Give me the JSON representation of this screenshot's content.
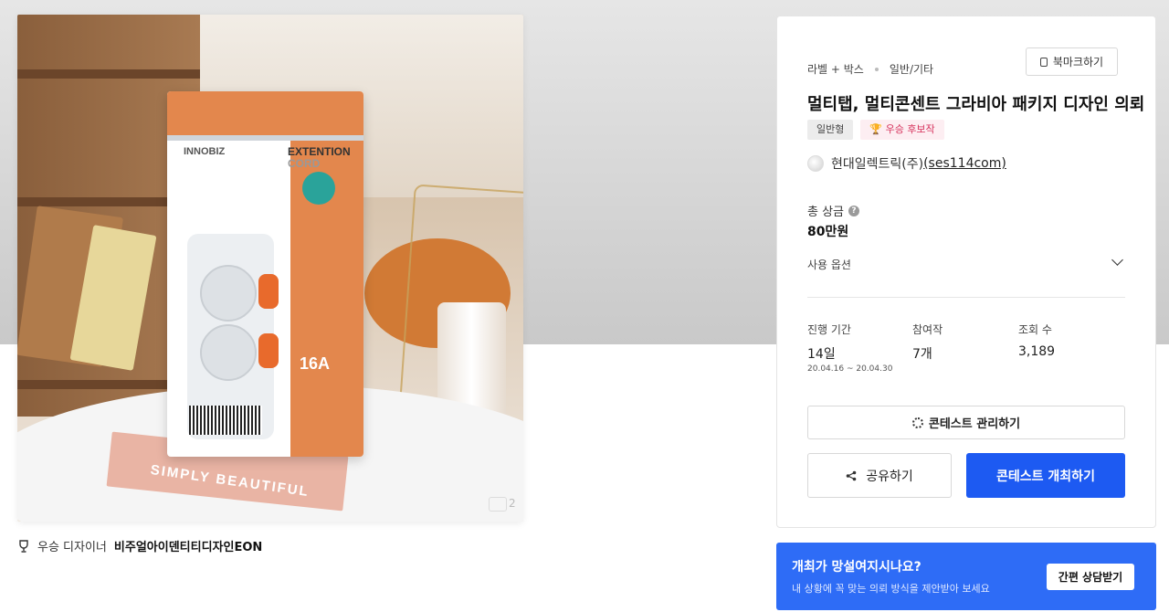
{
  "hero": {
    "pack_brand": "INNOBIZ",
    "pack_ext_line1": "EXTENTION",
    "pack_ext_line2": "CORD",
    "pack_rating": "16A",
    "magazine_text": "SIMPLY BEAUTIFUL",
    "page_indicator": "2"
  },
  "winner": {
    "label": "우승 디자이너",
    "name": "비주얼아이덴티티디자인EON"
  },
  "contest": {
    "category": "라벨 + 박스",
    "subcategory": "일반/기타",
    "bookmark_label": "북마크하기",
    "title": "멀티탭, 멀티콘센트 그라비아 패키지 디자인 의뢰",
    "tags": [
      "일반형",
      "우승 후보작"
    ],
    "company_name": "현대일렉트릭(주)",
    "company_id": "(ses114com)",
    "prize_label": "총 상금",
    "prize_value": "80만원",
    "options_label": "사용 옵션",
    "stats": {
      "period_label": "진행 기간",
      "period_value": "14일",
      "period_dates": "20.04.16 ~ 20.04.30",
      "entries_label": "참여작",
      "entries_value": "7개",
      "views_label": "조회 수",
      "views_value": "3,189"
    },
    "manage_label": "콘테스트 관리하기",
    "share_label": "공유하기",
    "host_label": "콘테스트 개최하기"
  },
  "consult": {
    "title": "개최가 망설여지시나요?",
    "subtitle": "내 상황에 꼭 맞는 의뢰 방식을 제안받아 보세요",
    "button": "간편 상담받기"
  },
  "colors": {
    "primary": "#1d5af2",
    "banner": "#2e6cf6",
    "win_tag": "#d6325c"
  }
}
